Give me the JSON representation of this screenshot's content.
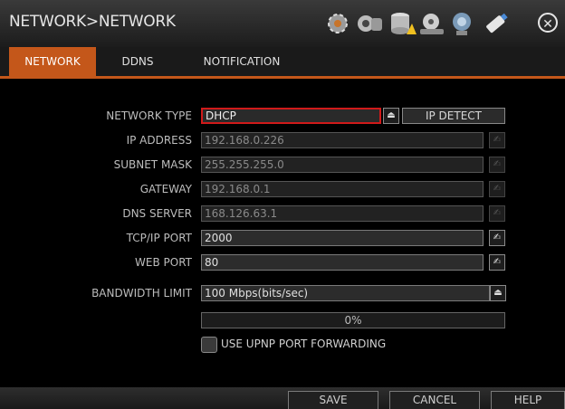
{
  "title": "NETWORK>NETWORK",
  "toolbar_icons": [
    "settings-icon",
    "camera-icon",
    "storage-icon",
    "recording-icon",
    "network-icon",
    "usb-icon"
  ],
  "tabs": [
    {
      "label": "NETWORK",
      "active": true
    },
    {
      "label": "DDNS",
      "active": false
    },
    {
      "label": "NOTIFICATION",
      "active": false
    }
  ],
  "form": {
    "network_type": {
      "label": "NETWORK TYPE",
      "value": "DHCP"
    },
    "ip_detect_label": "IP DETECT",
    "ip_address": {
      "label": "IP ADDRESS",
      "value": "192.168.0.226"
    },
    "subnet_mask": {
      "label": "SUBNET MASK",
      "value": "255.255.255.0"
    },
    "gateway": {
      "label": "GATEWAY",
      "value": "192.168.0.1"
    },
    "dns_server": {
      "label": "DNS SERVER",
      "value": "168.126.63.1"
    },
    "tcpip_port": {
      "label": "TCP/IP PORT",
      "value": "2000"
    },
    "web_port": {
      "label": "WEB PORT",
      "value": "80"
    },
    "bandwidth_limit": {
      "label": "BANDWIDTH LIMIT",
      "value": "100 Mbps(bits/sec)"
    },
    "progress_text": "0%",
    "upnp": {
      "label": "USE UPNP PORT FORWARDING",
      "checked": false
    }
  },
  "buttons": {
    "save": "SAVE",
    "cancel": "CANCEL",
    "help": "HELP"
  },
  "colors": {
    "accent": "#c4571a",
    "selection_border": "#d01a1a"
  }
}
